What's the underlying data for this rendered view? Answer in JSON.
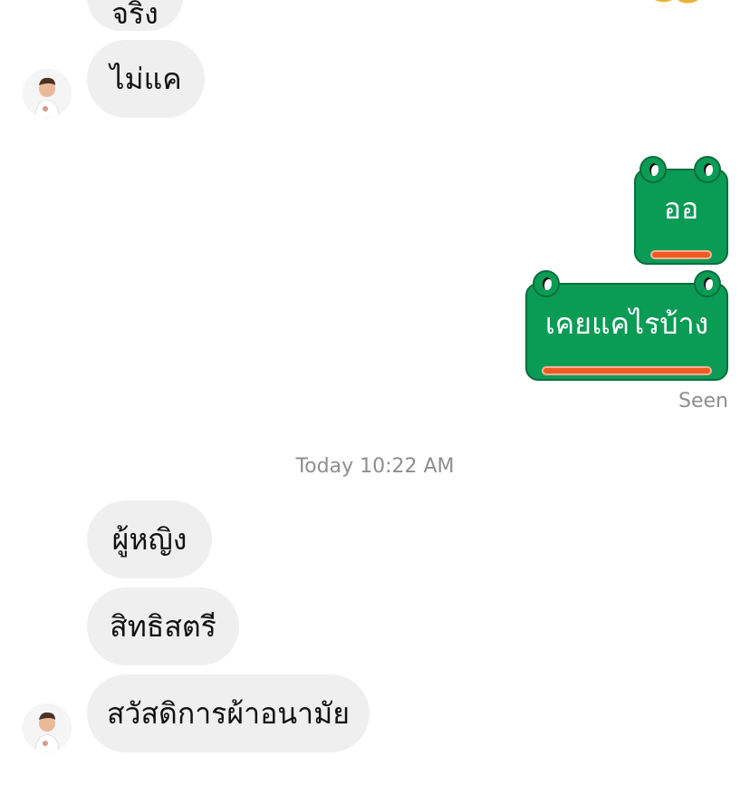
{
  "colors": {
    "incoming_bubble": "#efefef",
    "frog_green": "#0a9b55",
    "frog_mouth": "#f05a22",
    "meta_text": "#8e8e8e"
  },
  "messages": {
    "top_partial": "จริง",
    "msg1": "ไม่แค",
    "out1": "ออ",
    "out2": "เคยแคไรบ้าง",
    "seen": "Seen",
    "timestamp": "Today 10:22 AM",
    "msg2": "ผู้หญิง",
    "msg3": "สิทธิสตรี",
    "msg4": "สวัสดิการผ้าอนามัย"
  },
  "icons": {
    "avatar": "profile-photo",
    "top_sticker": "sticker-icon"
  }
}
